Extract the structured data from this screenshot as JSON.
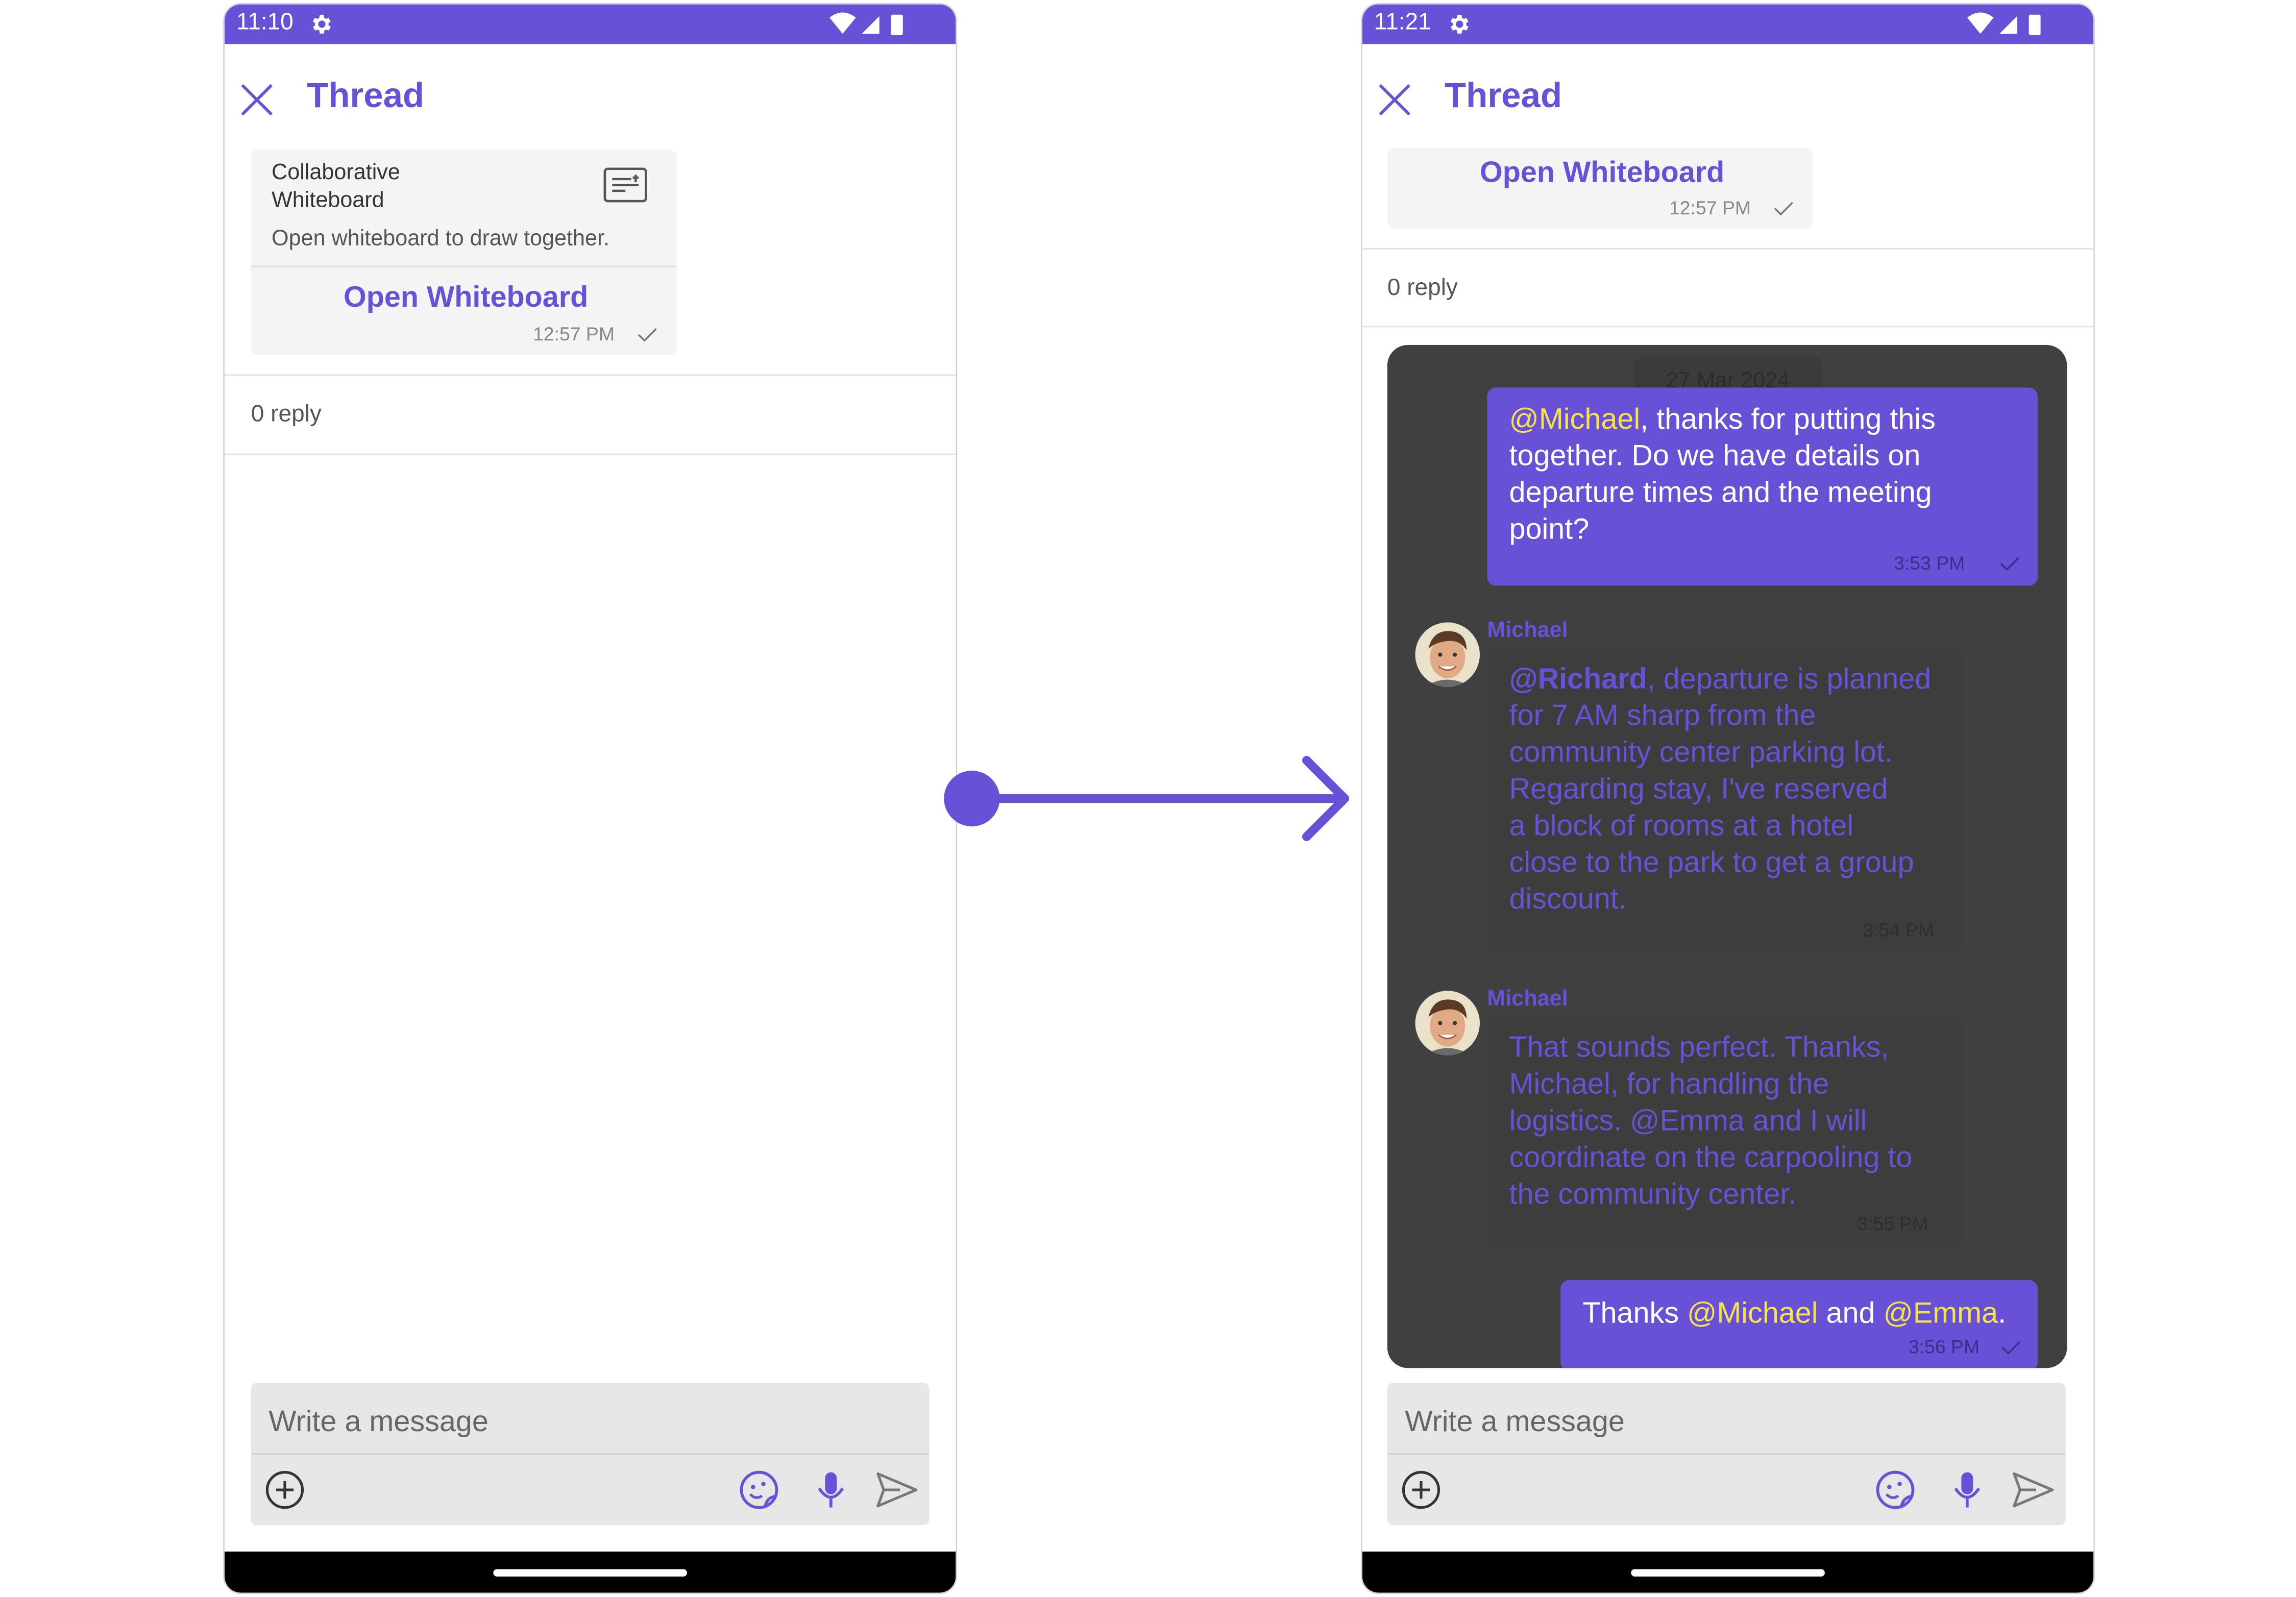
{
  "left_phone": {
    "status_time": "11:10",
    "title": "Thread",
    "card": {
      "title": "Collaborative Whiteboard",
      "description": "Open whiteboard to draw together.",
      "button_label": "Open Whiteboard",
      "time": "12:57 PM"
    },
    "reply_count": "0 reply",
    "composer_placeholder": "Write a message"
  },
  "right_phone": {
    "status_time": "11:21",
    "title": "Thread",
    "card": {
      "button_label": "Open Whiteboard",
      "time": "12:57 PM"
    },
    "reply_count": "0 reply",
    "date_separator": "27 Mar 2024",
    "messages": [
      {
        "direction": "outgoing",
        "mention": "@Michael",
        "lines": [
          ", thanks for putting this",
          "together. Do we have details on",
          "departure times and the meeting",
          "point?"
        ],
        "time": "3:53 PM"
      },
      {
        "direction": "incoming",
        "sender": "Michael",
        "mention": "@Richard",
        "lines": [
          ", departure is planned",
          "for 7 AM sharp from the",
          "community center parking lot.",
          "Regarding stay, I've reserved",
          "a block of rooms at a hotel",
          "close to the park to get a group",
          "discount."
        ],
        "time": "3:54 PM"
      },
      {
        "direction": "incoming",
        "sender": "Michael",
        "lines": [
          "That sounds perfect. Thanks,",
          "Michael, for handling the",
          "logistics. @Emma  and I will",
          "coordinate on the carpooling to",
          "the community center."
        ],
        "time": "3:55 PM"
      },
      {
        "direction": "outgoing",
        "prefix": "Thanks ",
        "mention_1": "@Michael",
        "middle": " and ",
        "mention_2": "@Emma",
        "suffix": ".",
        "time": "3:56 PM"
      }
    ],
    "composer_placeholder": "Write a message"
  },
  "colors": {
    "primary": "#6851d6",
    "mention": "#f6e34a",
    "chat_background": "#404040"
  },
  "icons": [
    "settings-gear-icon",
    "wifi-icon",
    "signal-icon",
    "battery-icon",
    "close-icon",
    "whiteboard-icon",
    "check-icon",
    "add-attachment-icon",
    "sticker-icon",
    "microphone-icon",
    "send-icon",
    "arrow-right-icon"
  ]
}
